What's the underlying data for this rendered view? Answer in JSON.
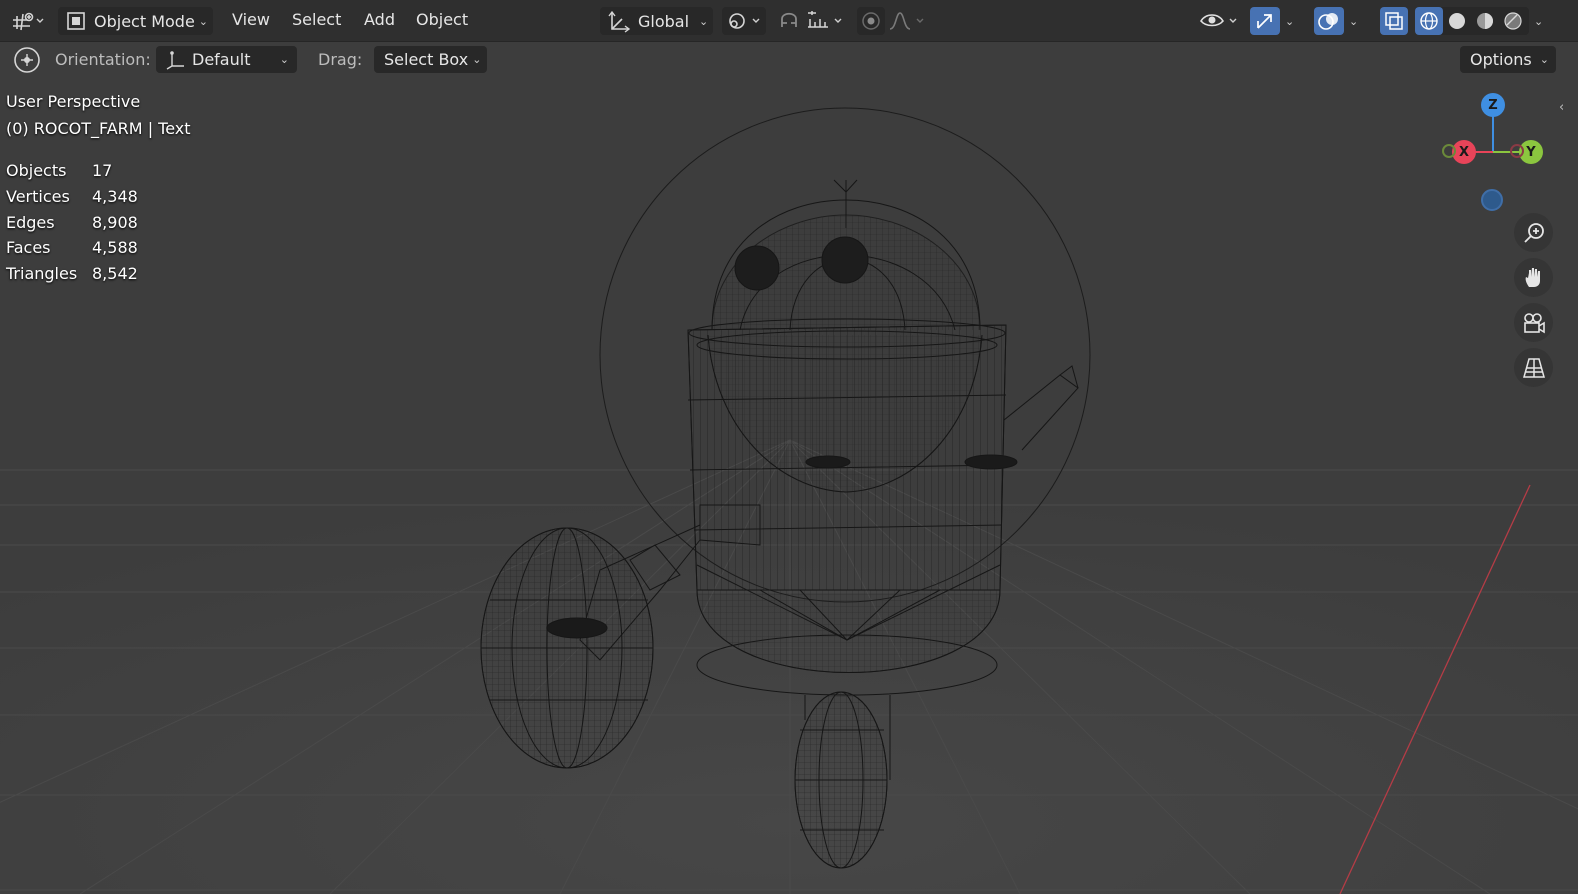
{
  "header": {
    "mode_label": "Object Mode",
    "menus": [
      "View",
      "Select",
      "Add",
      "Object"
    ],
    "transform_orientation": "Global"
  },
  "tool_settings": {
    "orientation_label": "Orientation:",
    "orientation_value": "Default",
    "drag_label": "Drag:",
    "drag_value": "Select Box",
    "options_label": "Options"
  },
  "overlay": {
    "perspective": "User Perspective",
    "object_info": "(0) ROCOT_FARM | Text",
    "stats": [
      {
        "label": "Objects",
        "value": "17"
      },
      {
        "label": "Vertices",
        "value": "4,348"
      },
      {
        "label": "Edges",
        "value": "8,908"
      },
      {
        "label": "Faces",
        "value": "4,588"
      },
      {
        "label": "Triangles",
        "value": "8,542"
      }
    ]
  },
  "gizmo": {
    "z_label": "Z",
    "x_label": "X",
    "y_label": "Y"
  },
  "colors": {
    "viewport_bg": "#3d3d3d",
    "header_bg": "#2f2f2f",
    "active_blue": "#4772b3",
    "axis_x": "#e84459",
    "axis_y": "#8bc63f",
    "axis_z": "#3f8fe2"
  },
  "icons": {
    "editor_type": "editor-type-icon",
    "mode": "object-mode-icon",
    "orientation": "transform-orientation-icon",
    "pivot": "pivot-point-icon",
    "snap": "snap-icon",
    "proportional": "proportional-editing-icon",
    "visibility": "visibility-icon",
    "gizmo": "gizmo-toggle-icon",
    "overlays": "overlays-icon",
    "xray": "xray-icon",
    "shading": [
      "wireframe-shading-icon",
      "solid-shading-icon",
      "material-preview-icon",
      "rendered-shading-icon"
    ],
    "navigation": [
      "zoom-icon",
      "pan-hand-icon",
      "camera-view-icon",
      "orthographic-grid-icon"
    ]
  }
}
